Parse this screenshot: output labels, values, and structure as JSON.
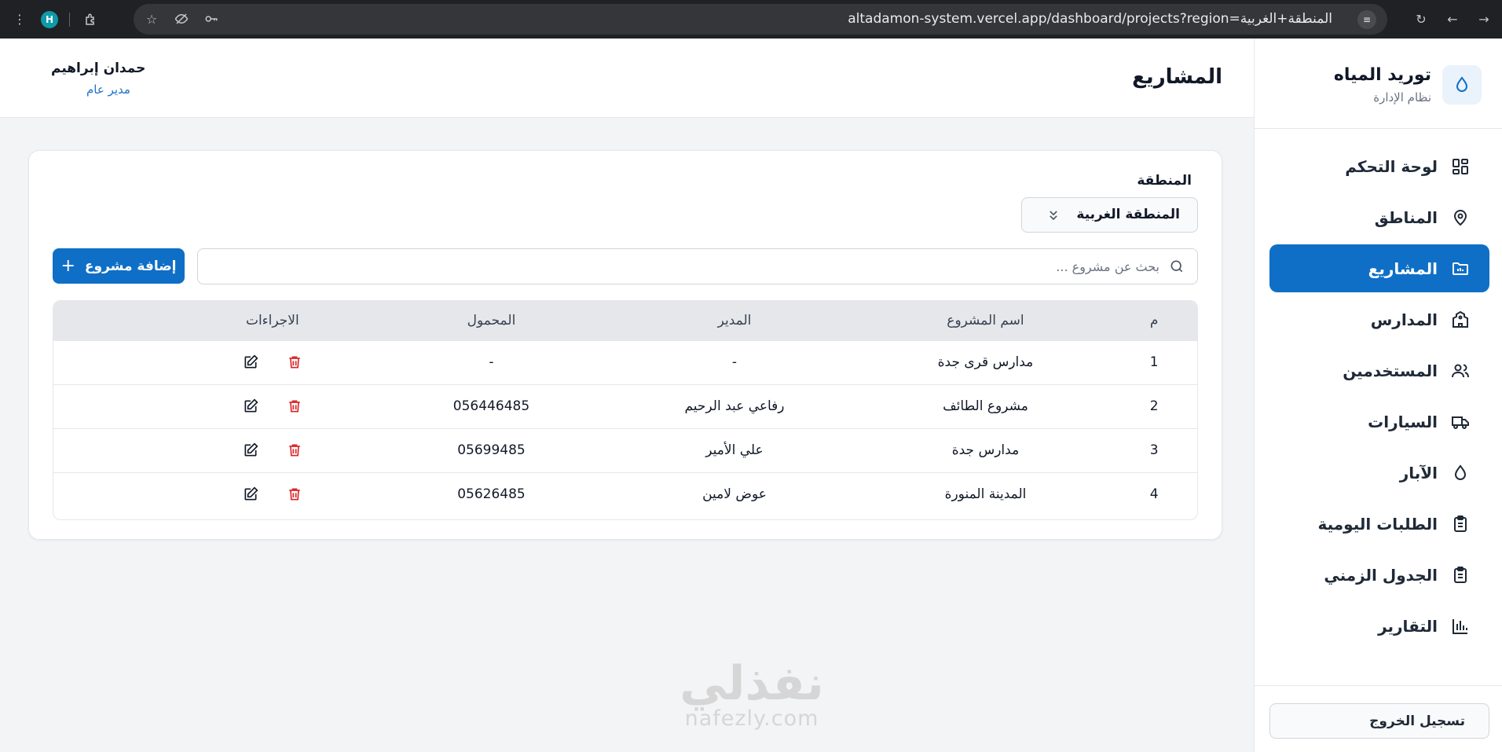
{
  "browser": {
    "url": "altadamon-system.vercel.app/dashboard/projects?region=المنطقة+الغربية",
    "profile_initial": "H"
  },
  "sidebar": {
    "brand_title": "توريد المياه",
    "brand_subtitle": "نظام الإدارة",
    "items": [
      {
        "label": "لوحة التحكم",
        "icon": "dashboard-icon",
        "active": false
      },
      {
        "label": "المناطق",
        "icon": "map-pin-icon",
        "active": false
      },
      {
        "label": "المشاريع",
        "icon": "folder-icon",
        "active": true
      },
      {
        "label": "المدارس",
        "icon": "school-icon",
        "active": false
      },
      {
        "label": "المستخدمين",
        "icon": "users-icon",
        "active": false
      },
      {
        "label": "السيارات",
        "icon": "truck-icon",
        "active": false
      },
      {
        "label": "الآبار",
        "icon": "droplet-icon",
        "active": false
      },
      {
        "label": "الطلبات اليومية",
        "icon": "clipboard-icon",
        "active": false
      },
      {
        "label": "الجدول الزمني",
        "icon": "clipboard-icon",
        "active": false
      },
      {
        "label": "التقارير",
        "icon": "bar-chart-icon",
        "active": false
      }
    ],
    "logout_label": "تسجيل الخروج"
  },
  "header": {
    "page_title": "المشاريع",
    "user_name": "حمدان إبراهيم",
    "user_role": "مدير عام"
  },
  "filters": {
    "region_label": "المنطقة",
    "region_value": "المنطقة الغربية"
  },
  "search": {
    "placeholder": "بحث عن مشروع ..."
  },
  "add_button_label": "إضافة مشروع",
  "table": {
    "headers": {
      "index": "م",
      "name": "اسم المشروع",
      "manager": "المدير",
      "mobile": "المحمول",
      "actions": "الاجراءات"
    },
    "rows": [
      {
        "index": "1",
        "name": "مدارس قرى جدة",
        "manager": "-",
        "mobile": "-"
      },
      {
        "index": "2",
        "name": "مشروع الطائف",
        "manager": "رفاعي عبد الرحيم",
        "mobile": "056446485"
      },
      {
        "index": "3",
        "name": "مدارس جدة",
        "manager": "علي الأمير",
        "mobile": "05699485"
      },
      {
        "index": "4",
        "name": "المدينة المنورة",
        "manager": "عوض لامين",
        "mobile": "05626485"
      }
    ]
  },
  "watermark": {
    "arabic": "نفذلي",
    "latin": "nafezly.com"
  },
  "colors": {
    "primary": "#0f6fc6",
    "danger": "#dc2626",
    "link": "#1d72c6"
  }
}
